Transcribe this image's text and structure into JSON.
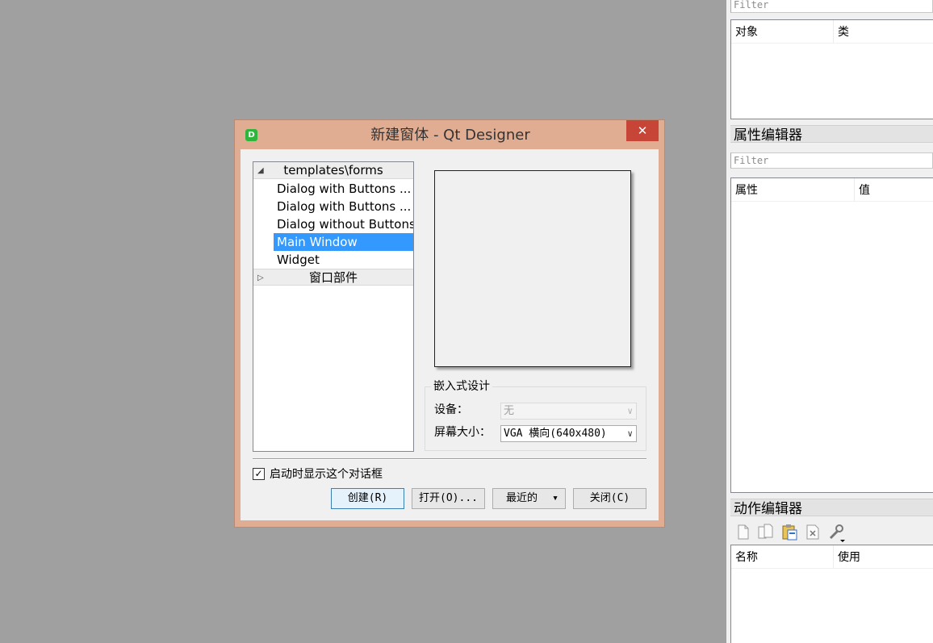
{
  "right_dock": {
    "object_inspector": {
      "filter_placeholder": "Filter",
      "columns": [
        "对象",
        "类"
      ]
    },
    "property_editor": {
      "title": "属性编辑器",
      "filter_placeholder": "Filter",
      "columns": [
        "属性",
        "值"
      ]
    },
    "action_editor": {
      "title": "动作编辑器",
      "toolbar_icons": [
        "new-action-icon",
        "copy-action-icon",
        "paste-action-icon",
        "delete-action-icon",
        "configure-wrench-icon"
      ],
      "columns": [
        "名称",
        "使用"
      ]
    }
  },
  "dialog": {
    "title": "新建窗体 - Qt Designer",
    "close_glyph": "✕",
    "app_icon_letter": "D",
    "tree": {
      "categories": [
        {
          "label": "templates\\forms",
          "expanded": true,
          "arrow": "◢",
          "items": [
            "Dialog with Buttons ...",
            "Dialog with Buttons ...",
            "Dialog without Buttons",
            "Main Window",
            "Widget"
          ],
          "selected": "Main Window"
        },
        {
          "label": "窗口部件",
          "expanded": false,
          "arrow": "▷",
          "items": []
        }
      ]
    },
    "embedded": {
      "group_title": "嵌入式设计",
      "device_label": "设备：",
      "device_value": "无",
      "screen_label": "屏幕大小：",
      "screen_value": "VGA 横向(640x480)",
      "dropdown_glyph": "∨"
    },
    "show_on_startup": {
      "label": "启动时显示这个对话框",
      "checked": true,
      "check_glyph": "✓"
    },
    "buttons": {
      "create": "创建(R)",
      "open": "打开(O)...",
      "recent": "最近的",
      "recent_arrow": "▾",
      "close": "关闭(C)"
    }
  },
  "colors": {
    "desktop_bg": "#a0a0a0",
    "dialog_frame": "#e1ad92",
    "close_button": "#c74536",
    "selection": "#3399ff"
  }
}
